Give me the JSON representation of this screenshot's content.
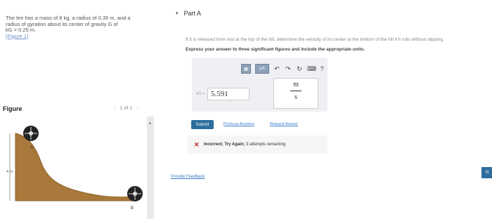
{
  "problem": {
    "line1": "The tire has a mass of 8 kg, a radius of 0.35 m, and a",
    "line2": "radius of gyration about its center of gravity G of",
    "line3": "kG = 0.25 m.",
    "figure_link": "(Figure 1)"
  },
  "figure": {
    "label": "Figure",
    "counter": "1 of 1",
    "prev_arrow": "‹",
    "next_arrow": "›",
    "point_a": "A",
    "point_b": "B",
    "height_label": "4 m",
    "colors": {
      "hill": "#a8793a",
      "hill_dark": "#8b5e25",
      "tire": "#222222",
      "hub": "#dddddd"
    }
  },
  "part": {
    "caret": "▾",
    "title": "Part A",
    "question": "If it is released from rest at the top of the hill, determine the velocity of its center at the bottom of the hill if it rolls without slipping.",
    "instruction": "Express your answer to three significant figures and include the appropriate units."
  },
  "answer": {
    "toolbar": {
      "template_btn": "▦",
      "mu_btn": "μA",
      "undo_icon": "↶",
      "redo_icon": "↷",
      "reset_icon": "↻",
      "keyboard_icon": "⌨",
      "help_icon": "?"
    },
    "variable": "vG =",
    "value": "5.591",
    "unit_numerator": "m",
    "unit_denominator": "s"
  },
  "actions": {
    "submit": "Submit",
    "previous_answers": "Previous Answers",
    "request_answer": "Request Answer"
  },
  "feedback": {
    "icon": "✕",
    "status": "Incorrect; Try Again;",
    "attempts": "3 attempts remaining"
  },
  "provide_feedback": "Provide Feedback",
  "next": "N"
}
